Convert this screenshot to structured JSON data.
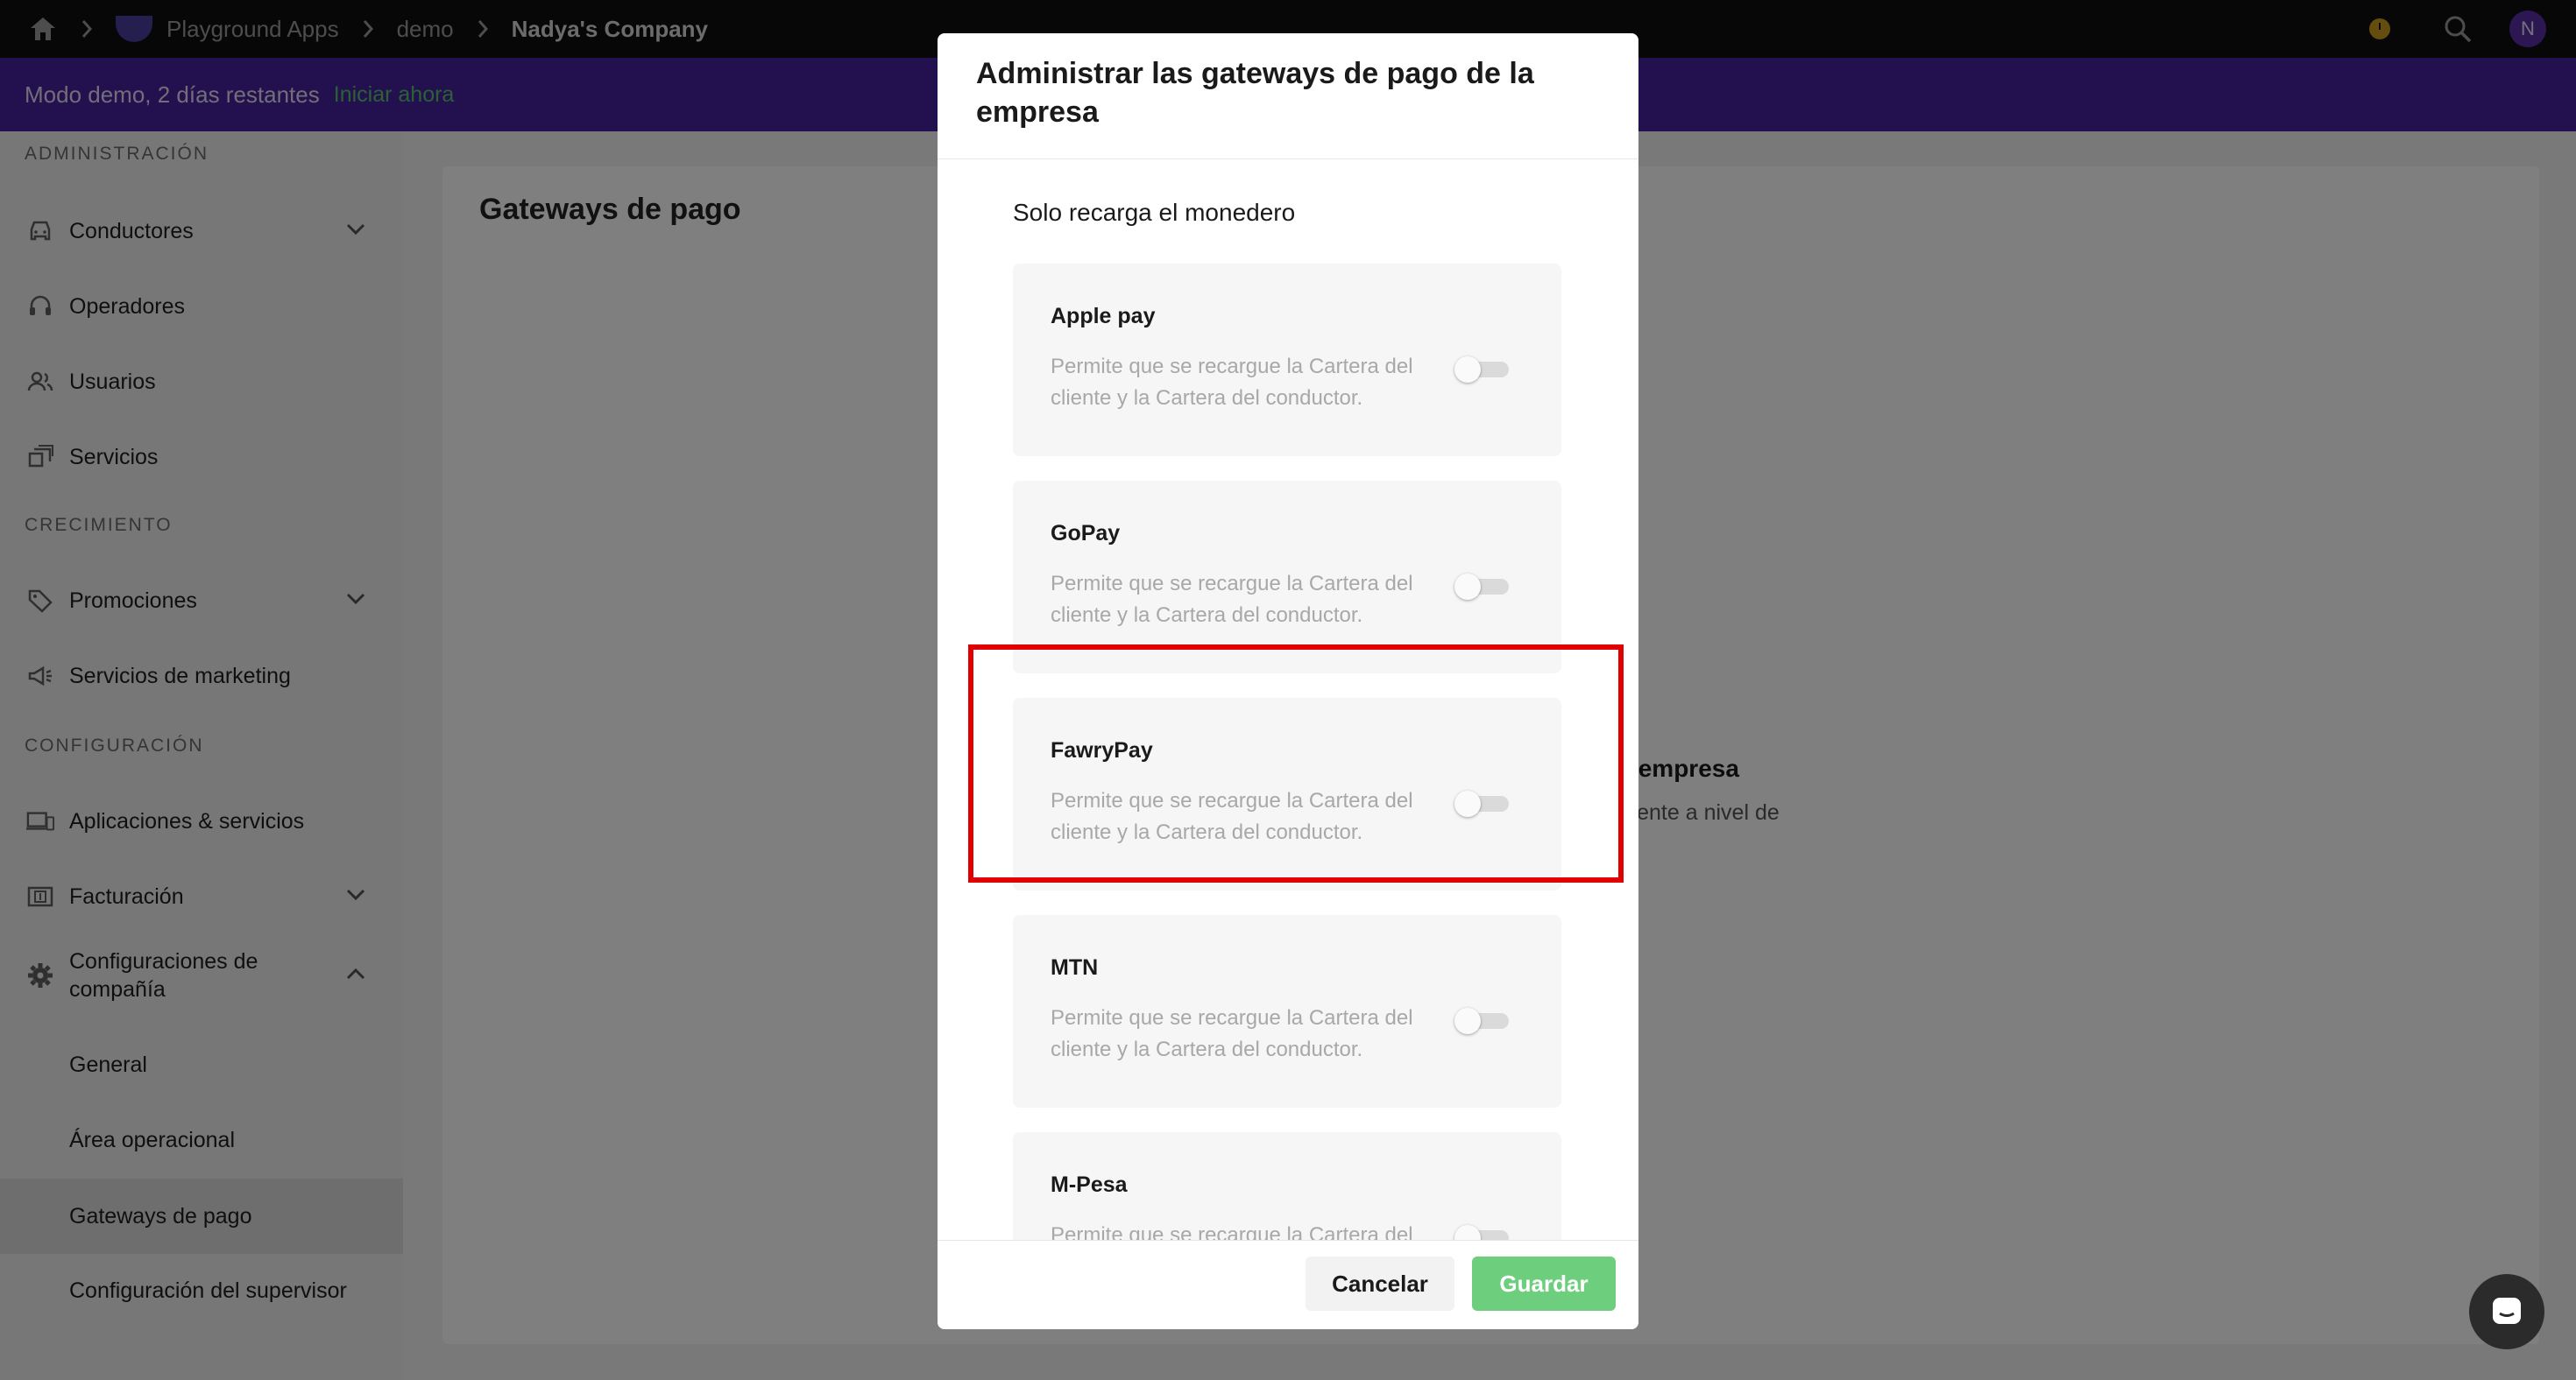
{
  "topbar": {
    "breadcrumbs": [
      "Playground Apps",
      "demo",
      "Nadya's Company"
    ],
    "avatar_initial": "N"
  },
  "banner": {
    "text": "Modo demo, 2 días restantes",
    "link": "Iniciar ahora"
  },
  "sidebar": {
    "sections": [
      "ADMINISTRACIÓN",
      "CRECIMIENTO",
      "CONFIGURACIÓN"
    ],
    "items": [
      {
        "label": "Conductores",
        "icon": "car-icon",
        "expandable": true
      },
      {
        "label": "Operadores",
        "icon": "headset-icon",
        "expandable": false
      },
      {
        "label": "Usuarios",
        "icon": "users-icon",
        "expandable": false
      },
      {
        "label": "Servicios",
        "icon": "services-icon",
        "expandable": false
      },
      {
        "label": "Promociones",
        "icon": "tag-icon",
        "expandable": true
      },
      {
        "label": "Servicios de marketing",
        "icon": "megaphone-icon",
        "expandable": false
      },
      {
        "label": "Aplicaciones & servicios",
        "icon": "devices-icon",
        "expandable": false
      },
      {
        "label": "Facturación",
        "icon": "billing-icon",
        "expandable": true
      },
      {
        "label": "Configuraciones de compañía",
        "icon": "gear-icon",
        "expandable": true,
        "expanded": true
      },
      {
        "label": "General"
      },
      {
        "label": "Área operacional"
      },
      {
        "label": "Gateways de pago",
        "active": true
      },
      {
        "label": "Configuración del supervisor"
      }
    ]
  },
  "main": {
    "title": "Gateways de pago",
    "empty_title_visible": "da en esta empresa",
    "empty_sub_visible": "dido previamente a nivel de"
  },
  "modal": {
    "title": "Administrar las gateways de pago de la empresa",
    "subtitle": "Solo recarga el monedero",
    "gateways": [
      {
        "name": "Apple pay",
        "description": "Permite que se recargue la Cartera del cliente y la Cartera del conductor.",
        "enabled": false
      },
      {
        "name": "GoPay",
        "description": "Permite que se recargue la Cartera del cliente y la Cartera del conductor.",
        "enabled": false
      },
      {
        "name": "FawryPay",
        "description": "Permite que se recargue la Cartera del cliente y la Cartera del conductor.",
        "enabled": false
      },
      {
        "name": "MTN",
        "description": "Permite que se recargue la Cartera del cliente y la Cartera del conductor.",
        "enabled": false
      },
      {
        "name": "M-Pesa",
        "description": "Permite que se recargue la Cartera del cliente y la Cartera del conductor.",
        "enabled": false
      }
    ],
    "cancel_label": "Cancelar",
    "save_label": "Guardar"
  },
  "colors": {
    "banner": "#46219c",
    "accent_green": "#6dcf7d",
    "highlight": "#e00000"
  }
}
